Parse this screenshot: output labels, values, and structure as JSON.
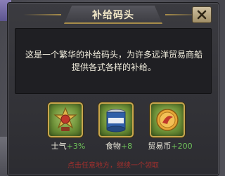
{
  "dialog": {
    "title": "补给码头",
    "description": "这是一个繁华的补给码头，为许多远洋贸易商船提供各式各样的补给。",
    "close_icon": "close-icon"
  },
  "rewards": [
    {
      "name": "士气",
      "amount": "+3%",
      "icon": "morale-medal-icon"
    },
    {
      "name": "食物",
      "amount": "+8",
      "icon": "food-can-icon"
    },
    {
      "name": "贸易币",
      "amount": "+200",
      "icon": "trade-coin-icon"
    }
  ],
  "footer": {
    "hint": "点击任意地方，继续一个领取"
  },
  "colors": {
    "accent_gold": "#c8a64e",
    "amount_green": "#6fc35a",
    "hint_red": "#c9302c"
  }
}
